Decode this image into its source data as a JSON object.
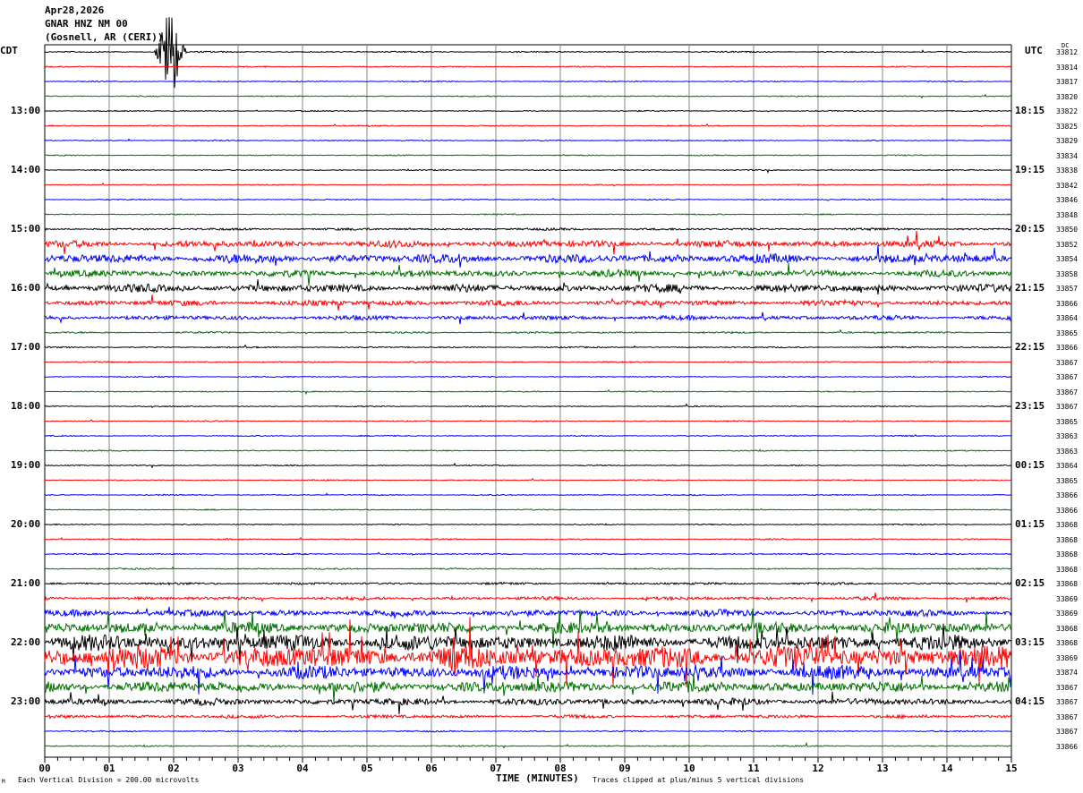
{
  "header": {
    "date": "Apr28,2026",
    "station": "GNAR HNZ NM 00",
    "location": "(Gosnell, AR (CERI))"
  },
  "left_axis_title": "CDT",
  "right_axis_title": "UTC",
  "dc_title": "DC",
  "footer": {
    "scale_note": "Each Vertical Division =  200.00 microvolts",
    "xlabel": "TIME (MINUTES)",
    "clip_note": "Traces clipped at plus/minus 5 vertical divisions",
    "corner_mark": "M"
  },
  "chart_data": {
    "type": "line",
    "title": "GNAR HNZ NM 00",
    "xlabel": "TIME (MINUTES)",
    "xlim": [
      0,
      15
    ],
    "x_ticks": [
      "00",
      "01",
      "02",
      "03",
      "04",
      "05",
      "06",
      "07",
      "08",
      "09",
      "10",
      "11",
      "12",
      "13",
      "14",
      "15"
    ],
    "trace_colors": [
      "#000000",
      "#ff0000",
      "#0000ff",
      "#007000"
    ],
    "grid": true,
    "left_time_labels": [
      {
        "row": 4,
        "label": "13:00"
      },
      {
        "row": 8,
        "label": "14:00"
      },
      {
        "row": 12,
        "label": "15:00"
      },
      {
        "row": 16,
        "label": "16:00"
      },
      {
        "row": 20,
        "label": "17:00"
      },
      {
        "row": 24,
        "label": "18:00"
      },
      {
        "row": 28,
        "label": "19:00"
      },
      {
        "row": 32,
        "label": "20:00"
      },
      {
        "row": 36,
        "label": "21:00"
      },
      {
        "row": 40,
        "label": "22:00"
      },
      {
        "row": 44,
        "label": "23:00"
      }
    ],
    "right_time_labels": [
      {
        "row": 4,
        "label": "18:15"
      },
      {
        "row": 8,
        "label": "19:15"
      },
      {
        "row": 12,
        "label": "20:15"
      },
      {
        "row": 16,
        "label": "21:15"
      },
      {
        "row": 20,
        "label": "22:15"
      },
      {
        "row": 24,
        "label": "23:15"
      },
      {
        "row": 28,
        "label": "00:15"
      },
      {
        "row": 32,
        "label": "01:15"
      },
      {
        "row": 36,
        "label": "02:15"
      },
      {
        "row": 40,
        "label": "03:15"
      },
      {
        "row": 44,
        "label": "04:15"
      }
    ],
    "dc_values": [
      "33812",
      "33814",
      "33817",
      "33820",
      "33822",
      "33825",
      "33829",
      "33834",
      "33838",
      "33842",
      "33846",
      "33848",
      "33850",
      "33852",
      "33854",
      "33858",
      "33857",
      "33866",
      "33864",
      "33865",
      "33866",
      "33867",
      "33867",
      "33867",
      "33867",
      "33865",
      "33863",
      "33863",
      "33864",
      "33865",
      "33866",
      "33866",
      "33868",
      "33868",
      "33868",
      "33868",
      "33868",
      "33869",
      "33869",
      "33868",
      "33868",
      "33869",
      "33874",
      "33867",
      "33867",
      "33867",
      "33867",
      "33866"
    ],
    "noise_level_divisions": [
      0.06,
      0.05,
      0.05,
      0.05,
      0.05,
      0.05,
      0.05,
      0.05,
      0.05,
      0.05,
      0.05,
      0.05,
      0.1,
      0.3,
      0.4,
      0.3,
      0.35,
      0.25,
      0.2,
      0.08,
      0.06,
      0.06,
      0.05,
      0.05,
      0.05,
      0.05,
      0.05,
      0.05,
      0.05,
      0.05,
      0.05,
      0.05,
      0.05,
      0.06,
      0.06,
      0.06,
      0.1,
      0.15,
      0.3,
      0.5,
      0.7,
      1.0,
      0.6,
      0.5,
      0.3,
      0.15,
      0.06,
      0.06
    ],
    "events": [
      {
        "row": 0,
        "minute": 1.95,
        "amplitude_divisions": 5,
        "duration_minutes": 0.25
      }
    ]
  }
}
